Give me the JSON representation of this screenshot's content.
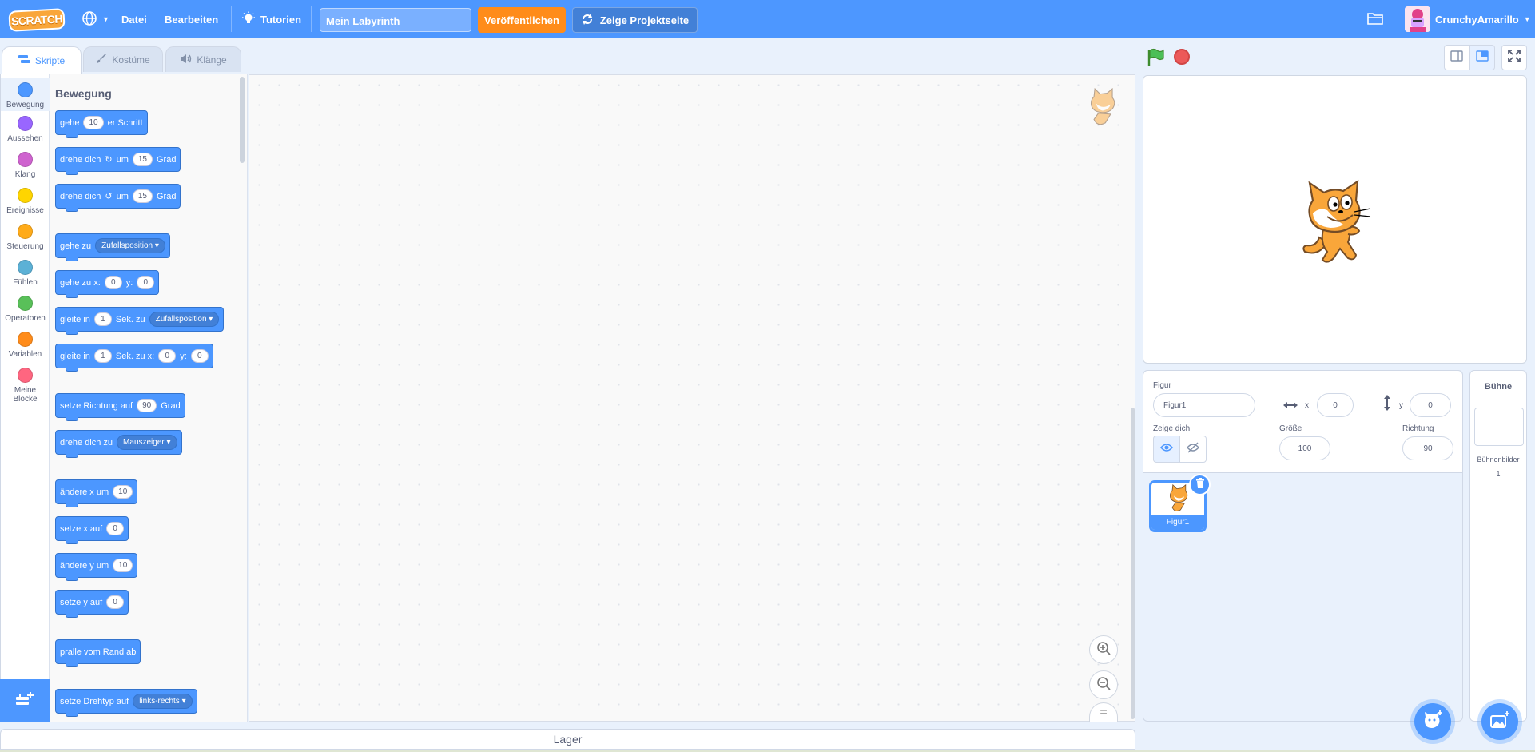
{
  "menubar": {
    "logo": "SCRATCH",
    "file": "Datei",
    "edit": "Bearbeiten",
    "tutorials": "Tutorien",
    "project_title": "Mein Labyrinth",
    "publish": "Veröffentlichen",
    "project_page": "Zeige Projektseite",
    "username": "CrunchyAmarillo"
  },
  "tabs": [
    {
      "label": "Skripte"
    },
    {
      "label": "Kostüme"
    },
    {
      "label": "Klänge"
    }
  ],
  "categories": [
    {
      "label": "Bewegung",
      "color": "#4c97ff"
    },
    {
      "label": "Aussehen",
      "color": "#9966ff"
    },
    {
      "label": "Klang",
      "color": "#cf63cf"
    },
    {
      "label": "Ereignisse",
      "color": "#ffd500"
    },
    {
      "label": "Steuerung",
      "color": "#ffab19"
    },
    {
      "label": "Fühlen",
      "color": "#5cb1d6"
    },
    {
      "label": "Operatoren",
      "color": "#59c059"
    },
    {
      "label": "Variablen",
      "color": "#ff8c1a"
    },
    {
      "label": "Meine Blöcke",
      "color": "#ff6680"
    }
  ],
  "palette": {
    "title": "Bewegung",
    "blocks": {
      "move": {
        "t1": "gehe",
        "v1": "10",
        "t2": "er Schritt"
      },
      "turn_right": {
        "t1": "drehe dich",
        "t2": "um",
        "v1": "15",
        "t3": "Grad"
      },
      "turn_left": {
        "t1": "drehe dich",
        "t2": "um",
        "v1": "15",
        "t3": "Grad"
      },
      "goto": {
        "t1": "gehe zu",
        "d1": "Zufallsposition"
      },
      "goto_xy": {
        "t1": "gehe zu x:",
        "v1": "0",
        "t2": "y:",
        "v2": "0"
      },
      "glide_to": {
        "t1": "gleite in",
        "v1": "1",
        "t2": "Sek. zu",
        "d1": "Zufallsposition"
      },
      "glide_xy": {
        "t1": "gleite in",
        "v1": "1",
        "t2": "Sek. zu x:",
        "v2": "0",
        "t3": "y:",
        "v3": "0"
      },
      "point_dir": {
        "t1": "setze Richtung auf",
        "v1": "90",
        "t2": "Grad"
      },
      "point_towards": {
        "t1": "drehe dich zu",
        "d1": "Mauszeiger"
      },
      "change_x": {
        "t1": "ändere x um",
        "v1": "10"
      },
      "set_x": {
        "t1": "setze x auf",
        "v1": "0"
      },
      "change_y": {
        "t1": "ändere y um",
        "v1": "10"
      },
      "set_y": {
        "t1": "setze y auf",
        "v1": "0"
      },
      "bounce": {
        "t1": "pralle vom Rand ab"
      },
      "rotation_style": {
        "t1": "setze Drehtyp auf",
        "d1": "links-rechts"
      }
    }
  },
  "lager": "Lager",
  "sprite_info": {
    "sprite_label": "Figur",
    "sprite_name": "Figur1",
    "x_label": "x",
    "x_value": "0",
    "y_label": "y",
    "y_value": "0",
    "show_label": "Zeige dich",
    "size_label": "Größe",
    "size_value": "100",
    "direction_label": "Richtung",
    "direction_value": "90"
  },
  "sprite_tiles": [
    {
      "name": "Figur1"
    }
  ],
  "stage_pane": {
    "title": "Bühne",
    "backdrops_label": "Bühnenbilder",
    "backdrops_count": "1"
  }
}
